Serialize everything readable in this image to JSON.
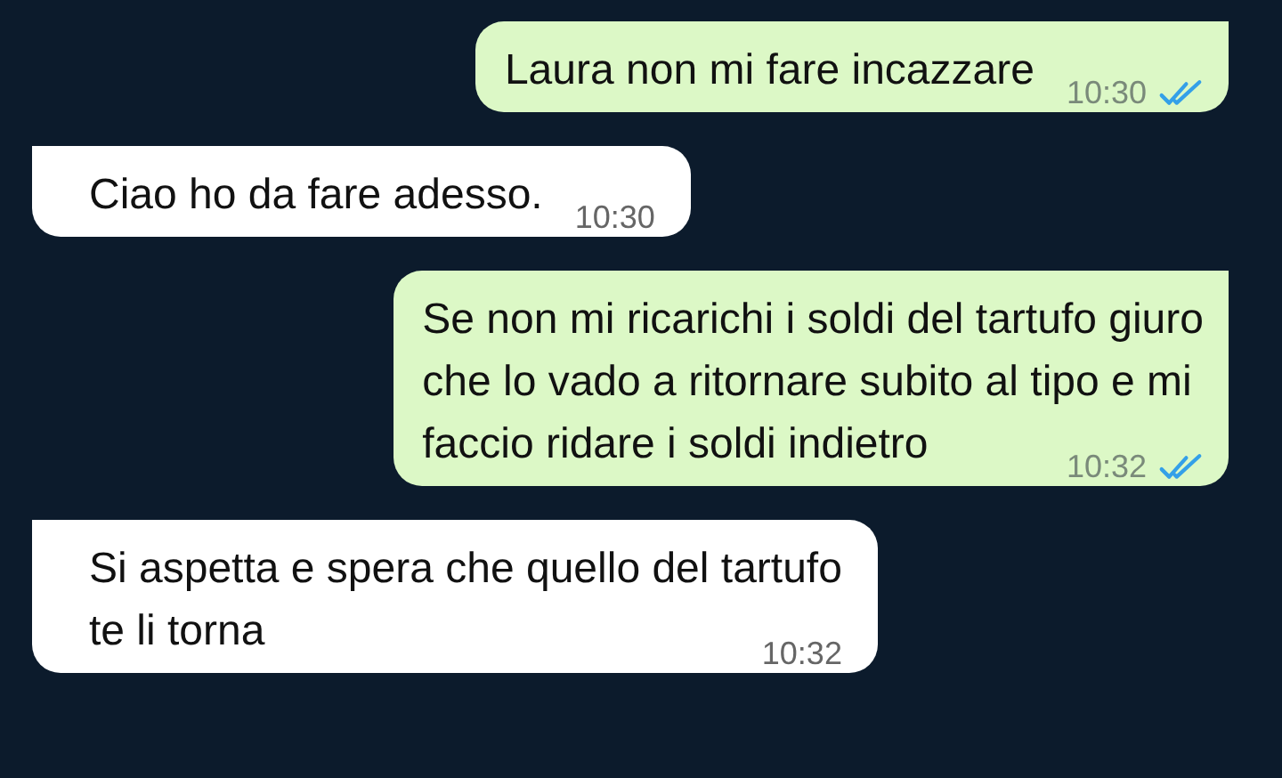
{
  "messages": [
    {
      "kind": "outgoing",
      "lines": [
        "Laura non mi fare incazzare"
      ],
      "time": "10:30",
      "read": true
    },
    {
      "kind": "incoming",
      "lines": [
        "Ciao ho da fare adesso."
      ],
      "time": "10:30"
    },
    {
      "kind": "outgoing",
      "lines": [
        "Se non mi ricarichi i soldi del tartufo giuro",
        "che lo vado a ritornare subito al tipo e mi",
        "faccio ridare i soldi indietro"
      ],
      "time": "10:32",
      "read": true
    },
    {
      "kind": "incoming",
      "lines": [
        "Si aspetta e spera che quello del tartufo",
        "te li torna"
      ],
      "time": "10:32"
    }
  ]
}
